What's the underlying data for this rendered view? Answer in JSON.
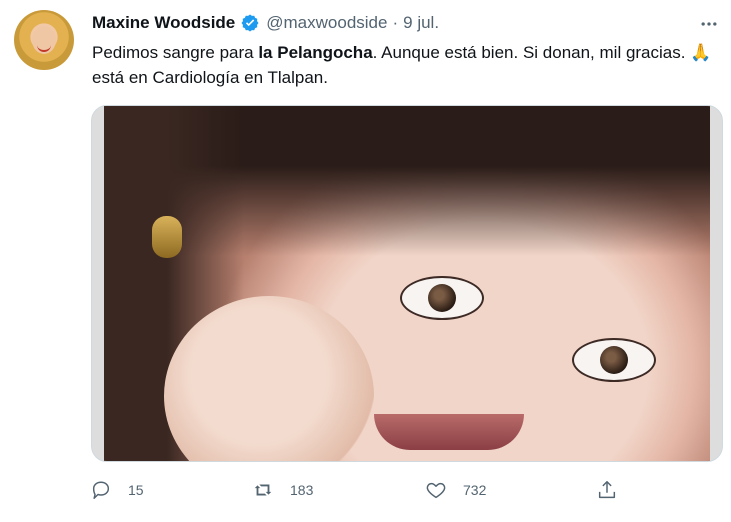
{
  "tweet": {
    "author": {
      "display_name": "Maxine Woodside",
      "handle": "@maxwoodside",
      "verified": true,
      "avatar_icon": "avatar-photo"
    },
    "separator": "·",
    "date": "9 jul.",
    "text_parts": {
      "line1_a": "Pedimos sangre para ",
      "line1_b": "la Pelangocha",
      "line1_c": ".  Aunque está bien. Si donan, mil gracias.  ",
      "emoji": "🙏",
      "line2": " está en Cardiología en Tlalpan."
    },
    "media": {
      "type": "photo",
      "description_icon": "portrait-photo"
    },
    "actions": {
      "reply_count": "15",
      "retweet_count": "183",
      "like_count": "732",
      "icons": [
        "reply-icon",
        "retweet-icon",
        "like-icon",
        "share-icon"
      ]
    }
  },
  "colors": {
    "text_primary": "#0f1419",
    "text_secondary": "#536471",
    "verified_blue": "#1d9bf0",
    "border": "#cfd9de"
  }
}
